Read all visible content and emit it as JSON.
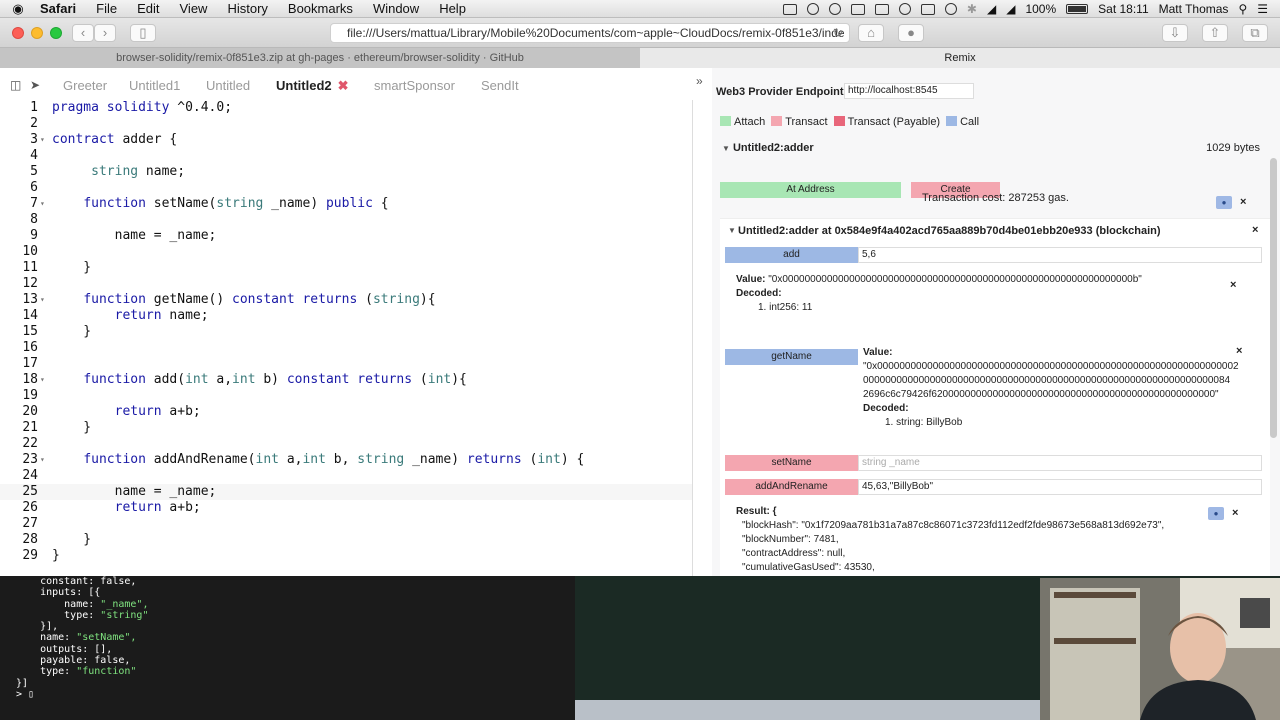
{
  "menubar": {
    "items": [
      "Safari",
      "File",
      "Edit",
      "View",
      "History",
      "Bookmarks",
      "Window",
      "Help"
    ],
    "battery": "100%",
    "clock": "Sat 18:11",
    "user": "Matt Thomas"
  },
  "browser": {
    "url": "file:///Users/mattua/Library/Mobile%20Documents/com~apple~CloudDocs/remix-0f851e3/inde",
    "tab_left": "browser-solidity/remix-0f851e3.zip at gh-pages · ethereum/browser-solidity · GitHub",
    "tab_right": "Remix"
  },
  "editor": {
    "tabs": [
      "Greeter",
      "Untitled1",
      "Untitled",
      "Untitled2",
      "smartSponsor",
      "SendIt"
    ],
    "active_tab": "Untitled2",
    "expand": "»",
    "lines": [
      "pragma solidity ^0.4.0;",
      "",
      "contract adder {",
      "",
      "     string name;",
      "",
      "    function setName(string _name) public {",
      "",
      "        name = _name;",
      "",
      "    }",
      "",
      "    function getName() constant returns (string){",
      "        return name;",
      "    }",
      "",
      "",
      "    function add(int a,int b) constant returns (int){",
      "",
      "        return a+b;",
      "    }",
      "",
      "    function addAndRename(int a,int b, string _name) returns (int) {",
      "",
      "        name = _name;",
      "        return a+b;",
      "",
      "    }",
      "}"
    ]
  },
  "panel": {
    "provider_label": "Web3 Provider Endpoint:",
    "provider_value": "http://localhost:8545",
    "legend": [
      {
        "label": "Attach",
        "color": "#a8e6b4"
      },
      {
        "label": "Transact",
        "color": "#f4a6b0"
      },
      {
        "label": "Transact (Payable)",
        "color": "#e8667a"
      },
      {
        "label": "Call",
        "color": "#9db8e4"
      }
    ],
    "contract_name": "Untitled2:adder",
    "bytes": "1029 bytes",
    "at_address": "At Address",
    "create": "Create",
    "tx_cost_label": "Transaction cost:",
    "tx_cost_value": "287253 gas.",
    "instance_title": "Untitled2:adder at 0x584e9f4a402acd765aa889b70d4be01ebb20e933 (blockchain)",
    "functions": [
      {
        "name": "add",
        "input": "5,6",
        "placeholder": ""
      },
      {
        "name": "getName",
        "input": "",
        "placeholder": ""
      },
      {
        "name": "setName",
        "input": "",
        "placeholder": "string _name"
      },
      {
        "name": "addAndRename",
        "input": "45,63,\"BillyBob\"",
        "placeholder": ""
      }
    ],
    "add_result": {
      "value_label": "Value:",
      "value": "\"0x000000000000000000000000000000000000000000000000000000000000000b\"",
      "decoded_label": "Decoded:",
      "decoded": "1.  int256: 11"
    },
    "getname_result": {
      "value_label": "Value:",
      "value_lines": [
        "\"0x00000000000000000000000000000000000000000000000000000000000000002",
        "000000000000000000000000000000000000000000000000000000000000000084",
        "2696c6c79426f620000000000000000000000000000000000000000000000000\""
      ],
      "decoded_label": "Decoded:",
      "decoded": "1.  string: BillyBob"
    },
    "tx_result": {
      "label": "Result: {",
      "lines": [
        "\"blockHash\": \"0x1f7209aa781b31a7a87c8c86071c3723fd112edf2fde98673e568a813d692e73\",",
        "\"blockNumber\": 7481,",
        "\"contractAddress\": null,",
        "\"cumulativeGasUsed\": 43530,"
      ]
    }
  },
  "terminal": {
    "lines": [
      {
        "t": "    constant: false,",
        "s": ""
      },
      {
        "t": "    inputs: [{",
        "s": ""
      },
      {
        "t": "        name: ",
        "s": "\"_name\","
      },
      {
        "t": "        type: ",
        "s": "\"string\""
      },
      {
        "t": "    }],",
        "s": ""
      },
      {
        "t": "    name: ",
        "s": "\"setName\","
      },
      {
        "t": "    outputs: [],",
        "s": ""
      },
      {
        "t": "    payable: false,",
        "s": ""
      },
      {
        "t": "    type: ",
        "s": "\"function\""
      },
      {
        "t": "}]",
        "s": ""
      },
      {
        "t": "> ▯",
        "s": ""
      }
    ]
  }
}
